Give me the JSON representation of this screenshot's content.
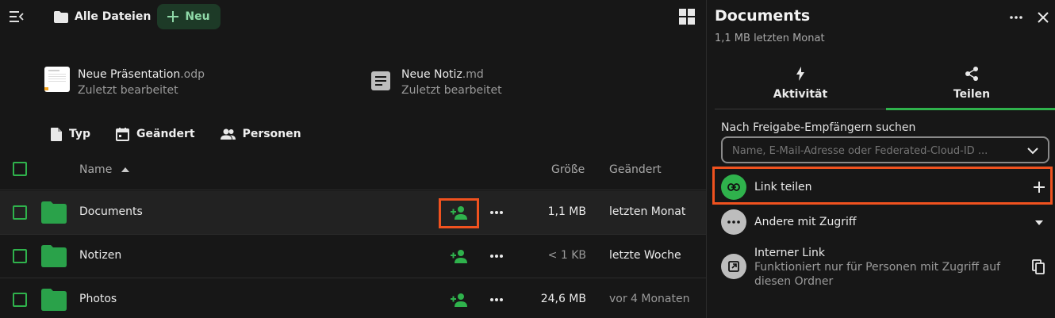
{
  "header": {
    "breadcrumb": "Alle Dateien",
    "new_label": "Neu"
  },
  "recent": [
    {
      "name": "Neue Präsentation",
      "ext": ".odp",
      "sub": "Zuletzt bearbeitet"
    },
    {
      "name": "Neue Notiz",
      "ext": ".md",
      "sub": "Zuletzt bearbeitet"
    }
  ],
  "filters": [
    "Typ",
    "Geändert",
    "Personen"
  ],
  "table": {
    "headers": {
      "name": "Name",
      "size": "Größe",
      "modified": "Geändert"
    },
    "rows": [
      {
        "name": "Documents",
        "size": "1,1 MB",
        "modified": "letzten Monat"
      },
      {
        "name": "Notizen",
        "size": "< 1 KB",
        "modified": "letzte Woche"
      },
      {
        "name": "Photos",
        "size": "24,6 MB",
        "modified": "vor 4 Monaten"
      }
    ]
  },
  "sidebar": {
    "title": "Documents",
    "subtitle": "1,1 MB letzten Monat",
    "tabs": [
      "Aktivität",
      "Teilen"
    ],
    "search_label": "Nach Freigabe-Empfängern suchen",
    "search_placeholder": "Name, E-Mail-Adresse oder Federated-Cloud-ID ...",
    "link_share": "Link teilen",
    "others_access": "Andere mit Zugriff",
    "internal_link_title": "Interner Link",
    "internal_link_desc": "Funktioniert nur für Personen mit Zugriff auf diesen Ordner"
  },
  "colors": {
    "accent": "#2fb24c",
    "highlight": "#f0521f",
    "folder": "#2aa24a"
  }
}
